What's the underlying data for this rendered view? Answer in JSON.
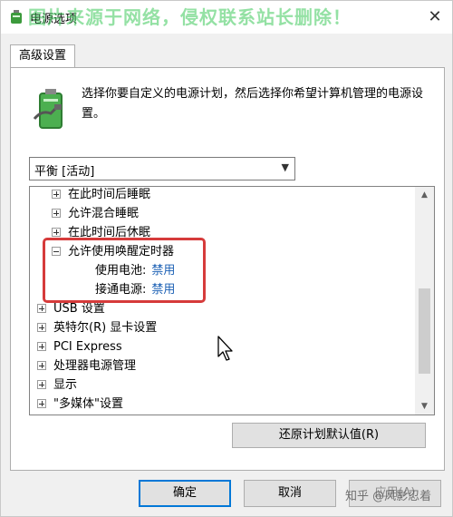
{
  "watermark": "图片来源于网络，侵权联系站长删除！",
  "window": {
    "title": "电源选项",
    "close_glyph": "✕"
  },
  "tabs": [
    {
      "label": "高级设置"
    }
  ],
  "description": "选择你要自定义的电源计划，然后选择你希望计算机管理的电源设置。",
  "plan_select": {
    "value": "平衡 [活动]"
  },
  "tree": {
    "items": [
      {
        "label": "在此时间后睡眠",
        "expander": "plus"
      },
      {
        "label": "允许混合睡眠",
        "expander": "plus"
      },
      {
        "label": "在此时间后休眠",
        "expander": "plus"
      },
      {
        "label": "允许使用唤醒定时器",
        "expander": "minus"
      },
      {
        "label": "USB 设置",
        "expander": "plus"
      },
      {
        "label": "英特尔(R) 显卡设置",
        "expander": "plus"
      },
      {
        "label": "PCI Express",
        "expander": "plus"
      },
      {
        "label": "处理器电源管理",
        "expander": "plus"
      },
      {
        "label": "显示",
        "expander": "plus"
      },
      {
        "label": "\"多媒体\"设置",
        "expander": "plus"
      }
    ],
    "settings": [
      {
        "label": "使用电池:",
        "value": "禁用"
      },
      {
        "label": "接通电源:",
        "value": "禁用"
      }
    ]
  },
  "buttons": {
    "restore": "还原计划默认值(R)",
    "ok": "确定",
    "cancel": "取消",
    "apply": "应用(A)"
  },
  "credit": "知乎 @风影忍着",
  "colors": {
    "accent": "#0078d7",
    "highlight": "#d63b3b",
    "link": "#1a5fb4"
  }
}
